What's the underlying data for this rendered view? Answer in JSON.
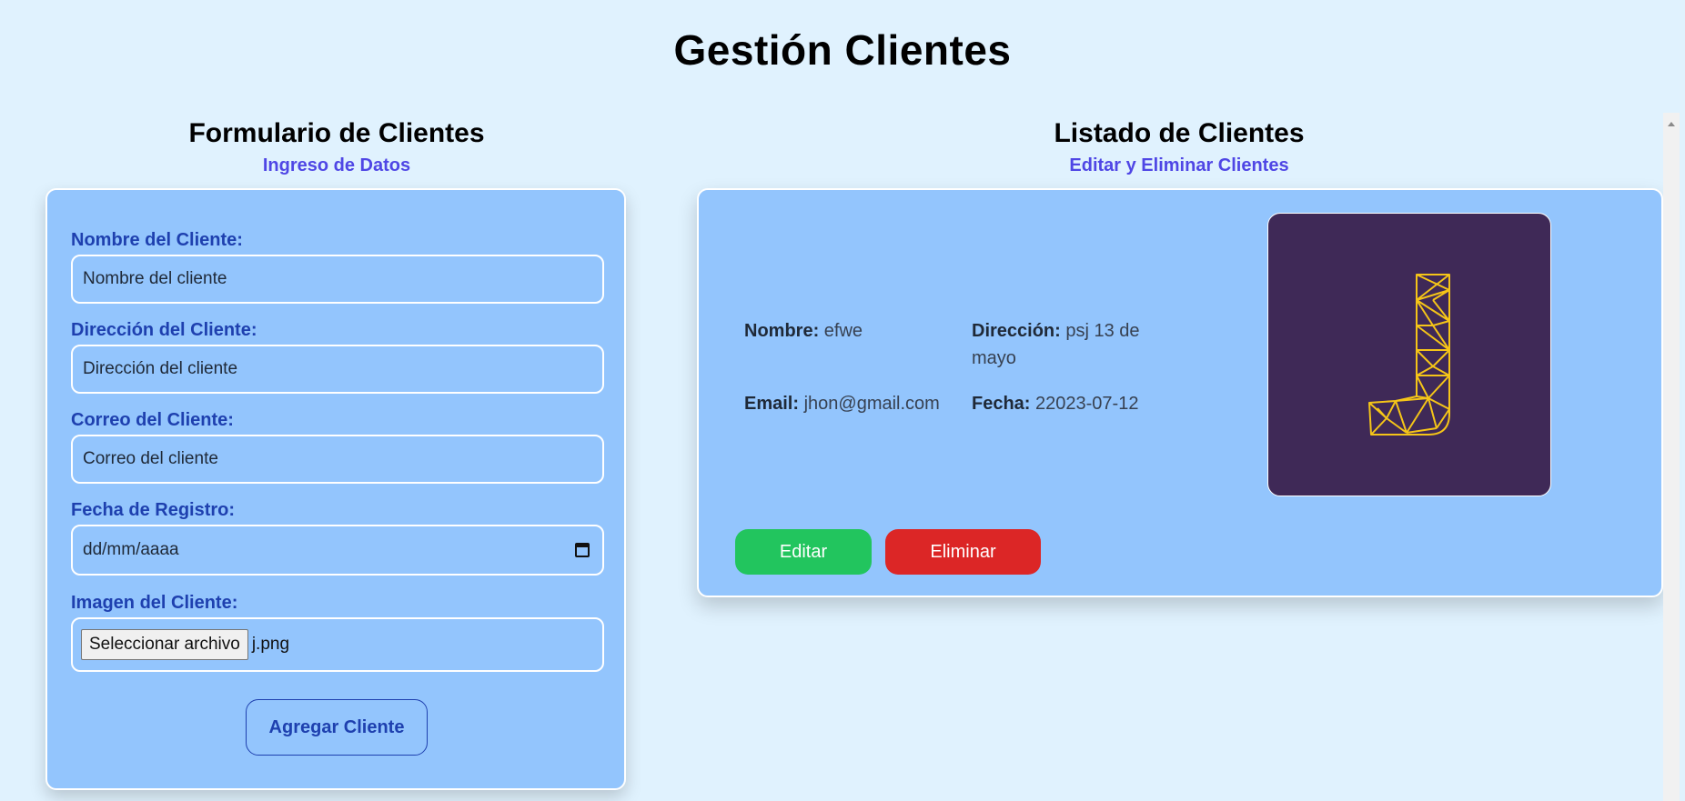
{
  "page": {
    "title": "Gestión Clientes"
  },
  "form": {
    "title": "Formulario de Clientes",
    "subtitle": "Ingreso de Datos",
    "name_label": "Nombre del Cliente:",
    "name_placeholder": "Nombre del cliente",
    "address_label": "Dirección del Cliente:",
    "address_placeholder": "Dirección del cliente",
    "email_label": "Correo del Cliente:",
    "email_placeholder": "Correo del cliente",
    "date_label": "Fecha de Registro:",
    "date_placeholder": "dd/mm/aaaa",
    "image_label": "Imagen del Cliente:",
    "file_button": "Seleccionar archivo",
    "file_name": "j.png",
    "submit": "Agregar Cliente"
  },
  "list": {
    "title": "Listado de Clientes",
    "subtitle": "Editar y Eliminar Clientes",
    "clients": [
      {
        "name_label": "Nombre:",
        "name": "efwe",
        "address_label": "Dirección:",
        "address": "psj 13 de mayo",
        "email_label": "Email:",
        "email": "jhon@gmail.com",
        "date_label": "Fecha:",
        "date": "22023-07-12",
        "image": "letter-j-polygon-icon",
        "edit": "Editar",
        "delete": "Eliminar"
      }
    ]
  },
  "colors": {
    "background": "#e0f2fe",
    "card": "#93c5fd",
    "label": "#1e40af",
    "subtitle": "#4f46e5",
    "edit": "#22c55e",
    "delete": "#dc2626",
    "image_bg": "#3f2957",
    "image_stroke": "#f5c518"
  }
}
